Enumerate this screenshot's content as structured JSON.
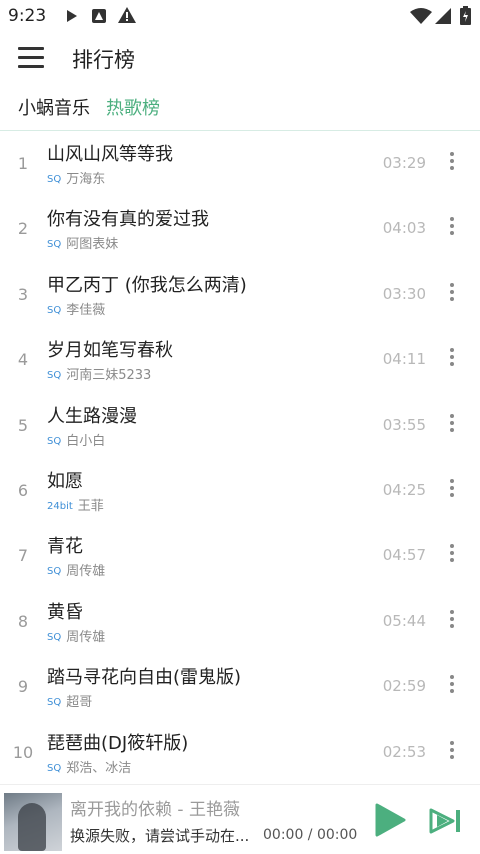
{
  "status_bar": {
    "time": "9:23"
  },
  "app_bar": {
    "title": "排行榜"
  },
  "tabs": [
    {
      "label": "小蜗音乐",
      "active": false
    },
    {
      "label": "热歌榜",
      "active": true
    }
  ],
  "colors": {
    "accent": "#4caf7f",
    "badge": "#3f8fd6"
  },
  "songs": [
    {
      "rank": "1",
      "title": "山风山风等等我",
      "quality": "SQ",
      "artist": "万海东",
      "duration": "03:29"
    },
    {
      "rank": "2",
      "title": "你有没有真的爱过我",
      "quality": "SQ",
      "artist": "阿图表妹",
      "duration": "04:03"
    },
    {
      "rank": "3",
      "title": "甲乙丙丁 (你我怎么两清)",
      "quality": "SQ",
      "artist": "李佳薇",
      "duration": "03:30"
    },
    {
      "rank": "4",
      "title": "岁月如笔写春秋",
      "quality": "SQ",
      "artist": "河南三妹5233",
      "duration": "04:11"
    },
    {
      "rank": "5",
      "title": "人生路漫漫",
      "quality": "SQ",
      "artist": "白小白",
      "duration": "03:55"
    },
    {
      "rank": "6",
      "title": "如愿",
      "quality": "24bit",
      "artist": "王菲",
      "duration": "04:25"
    },
    {
      "rank": "7",
      "title": "青花",
      "quality": "SQ",
      "artist": "周传雄",
      "duration": "04:57"
    },
    {
      "rank": "8",
      "title": "黄昏",
      "quality": "SQ",
      "artist": "周传雄",
      "duration": "05:44"
    },
    {
      "rank": "9",
      "title": "踏马寻花向自由(雷鬼版)",
      "quality": "SQ",
      "artist": "超哥",
      "duration": "02:59"
    },
    {
      "rank": "10",
      "title": "琵琶曲(DJ筱轩版)",
      "quality": "SQ",
      "artist": "郑浩、冰洁",
      "duration": "02:53"
    }
  ],
  "now_playing": {
    "title": "离开我的依赖 - 王艳薇",
    "status": "换源失败，请尝试手动在...",
    "time": "00:00 / 00:00"
  }
}
